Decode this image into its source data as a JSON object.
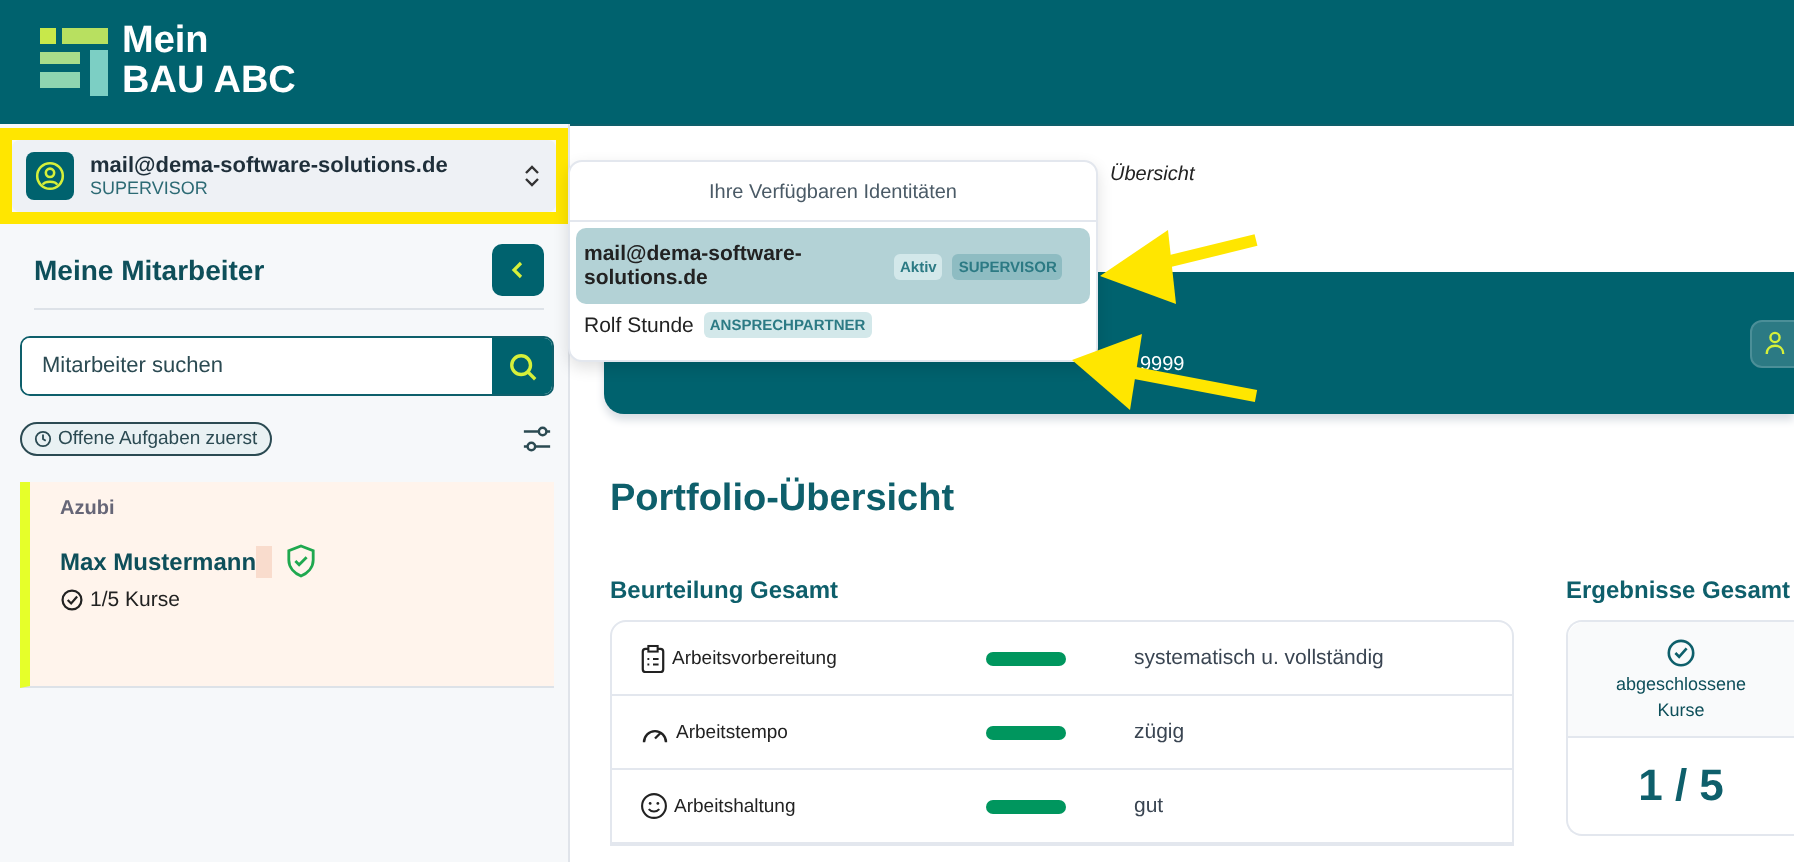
{
  "header": {
    "logo_line_1": "Mein",
    "logo_line_2": "BAU ABC"
  },
  "identity_selector": {
    "email": "mail@dema-software-solutions.de",
    "role": "SUPERVISOR",
    "highlighted": true
  },
  "sidebar": {
    "title": "Meine Mitarbeiter",
    "search": {
      "placeholder": "Mitarbeiter suchen"
    },
    "filter_chip": {
      "label": "Offene Aufgaben zuerst",
      "selected": true
    },
    "employees": [
      {
        "group": "Azubi",
        "name": "Max Mustermann",
        "courses": "1/5 Kurse",
        "verified": true,
        "selected": true
      }
    ]
  },
  "breadcrumb": "Übersicht",
  "banner": {
    "text": "9999"
  },
  "identity_dropdown": {
    "title": "Ihre Verfügbaren Identitäten",
    "items": [
      {
        "name": "mail@dema-software-solutions.de",
        "status": "Aktiv",
        "role": "SUPERVISOR",
        "selected": true
      },
      {
        "name": "Rolf Stunde",
        "role": "ANSPRECHPARTNER",
        "selected": false
      }
    ]
  },
  "portfolio": {
    "title": "Portfolio-Übersicht",
    "rating_title": "Beurteilung Gesamt",
    "ratings": [
      {
        "kind": "clipboard",
        "label": "Arbeitsvorbereitung",
        "value": "systematisch u. vollständig"
      },
      {
        "kind": "gauge",
        "label": "Arbeitstempo",
        "value": "zügig"
      },
      {
        "kind": "smile",
        "label": "Arbeitshaltung",
        "value": "gut"
      }
    ],
    "results_title": "Ergebnisse Gesamt",
    "results": {
      "label_line_1": "abgeschlossene",
      "label_line_2": "Kurse",
      "value": "1 / 5"
    }
  },
  "annotations": [
    {
      "kind": "arrow",
      "selected": true
    },
    {
      "kind": "arrow",
      "selected": true
    }
  ]
}
